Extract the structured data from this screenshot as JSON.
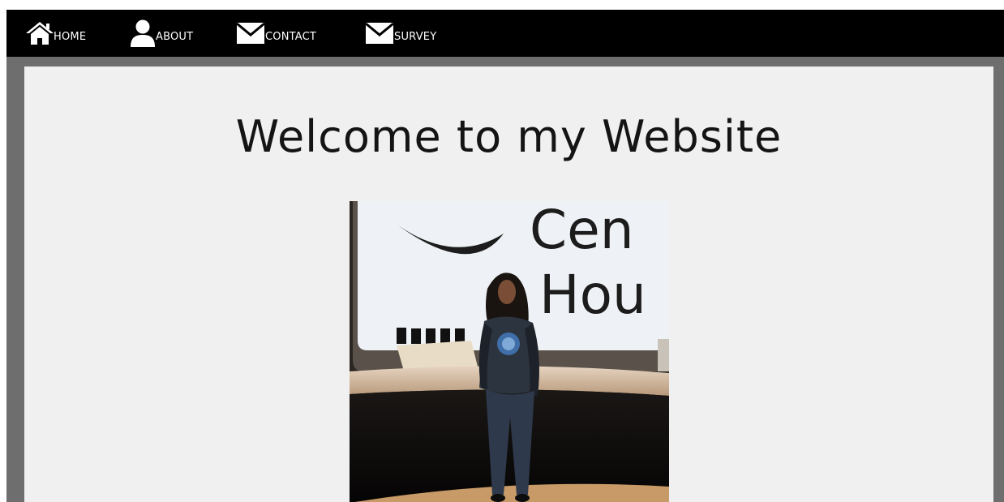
{
  "nav": {
    "items": [
      {
        "label": "HOME",
        "icon": "home-icon"
      },
      {
        "label": "ABOUT",
        "icon": "user-icon"
      },
      {
        "label": "CONTACT",
        "icon": "envelope-icon"
      },
      {
        "label": "SURVEY",
        "icon": "envelope-icon"
      }
    ]
  },
  "main": {
    "title": "Welcome to my Website",
    "photo_sign_text_line1": "Cen",
    "photo_sign_text_line2": "Hou"
  },
  "colors": {
    "navbar_bg": "#000000",
    "frame_bg": "#6e6e6e",
    "content_bg": "#f0f0f0",
    "nav_text": "#ffffff",
    "title_text": "#141414"
  }
}
